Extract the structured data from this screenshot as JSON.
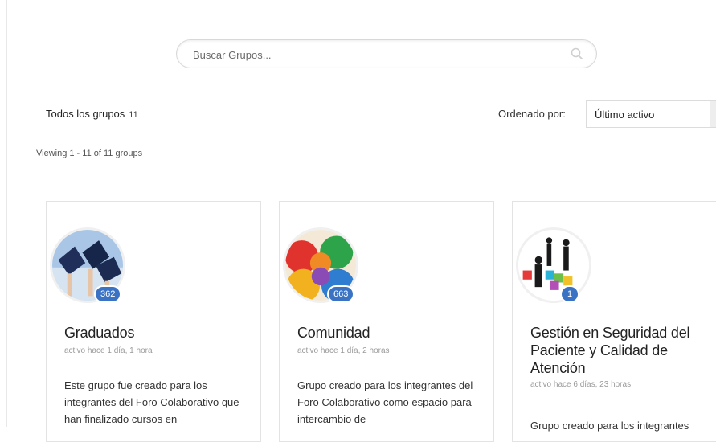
{
  "search": {
    "placeholder": "Buscar Grupos..."
  },
  "filter": {
    "all_groups_label": "Todos los grupos",
    "all_groups_count": "11",
    "order_label": "Ordenado por:",
    "order_value": "Último activo"
  },
  "viewing_text": "Viewing 1 - 11 of 11 groups",
  "groups": [
    {
      "title": "Graduados",
      "members": "362",
      "meta": "activo hace 1 día, 1 hora",
      "description": "Este grupo fue creado para los integrantes del Foro Colaborativo que han finalizado cursos en"
    },
    {
      "title": "Comunidad",
      "members": "663",
      "meta": "activo hace 1 día, 2 horas",
      "description": "Grupo creado para los integrantes del Foro Colaborativo como espacio para intercambio de"
    },
    {
      "title": "Gestión en Seguridad del Paciente y Calidad de Atención",
      "members": "1",
      "meta": "activo hace 6 días, 23 horas",
      "description": "Grupo creado para los integrantes"
    }
  ],
  "icons": {
    "search": "search-icon",
    "order_dropdown": "chevron-down-icon"
  },
  "colors": {
    "badge": "#3a73c4"
  }
}
